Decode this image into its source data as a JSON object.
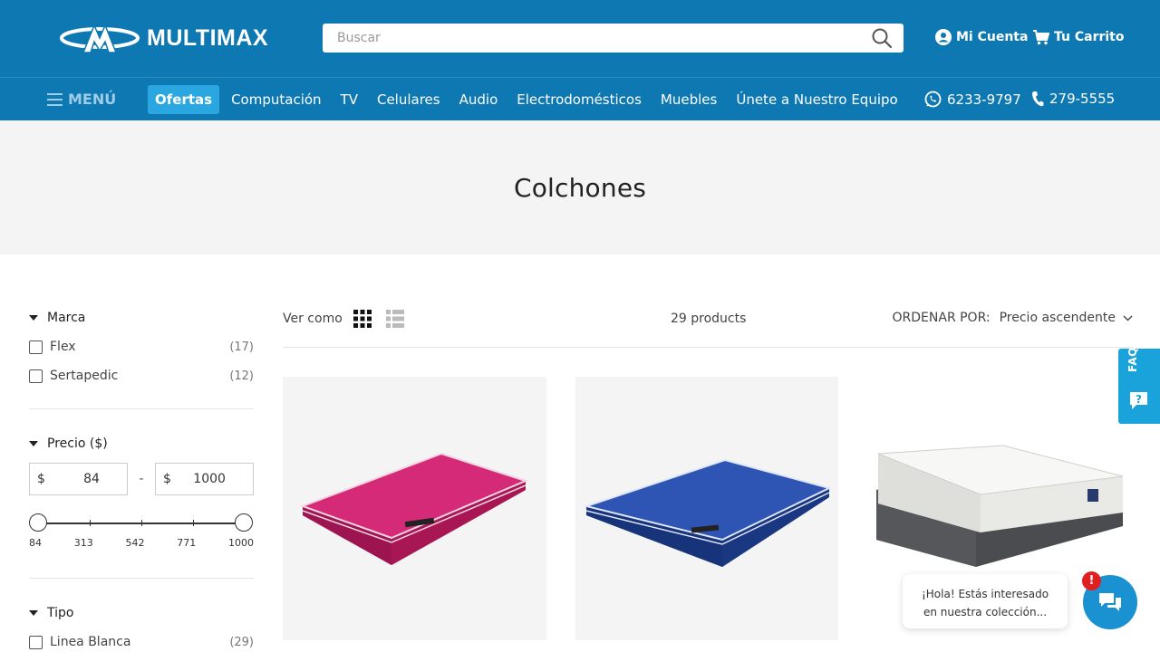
{
  "header": {
    "brand": "MULTIMAX",
    "search_placeholder": "Buscar",
    "account_label": "Mi Cuenta",
    "cart_label": "Tu Carrito"
  },
  "nav": {
    "menu_label": "MENÚ",
    "items": [
      {
        "label": "Ofertas",
        "active": true
      },
      {
        "label": "Computación"
      },
      {
        "label": "TV"
      },
      {
        "label": "Celulares"
      },
      {
        "label": "Audio"
      },
      {
        "label": "Electrodomésticos"
      },
      {
        "label": "Muebles"
      },
      {
        "label": "Únete a Nuestro Equipo"
      }
    ],
    "whatsapp_phone": "6233-9797",
    "phone": "279-5555"
  },
  "page": {
    "title": "Colchones"
  },
  "filters": {
    "brand": {
      "title": "Marca",
      "options": [
        {
          "label": "Flex",
          "count": "(17)"
        },
        {
          "label": "Sertapedic",
          "count": "(12)"
        }
      ]
    },
    "price": {
      "title": "Precio ($)",
      "currency": "$",
      "min": "84",
      "max": "1000",
      "separator": "-",
      "ticks": [
        "84",
        "313",
        "542",
        "771",
        "1000"
      ]
    },
    "type": {
      "title": "Tipo",
      "options": [
        {
          "label": "Linea Blanca",
          "count": "(29)"
        }
      ]
    }
  },
  "toolbar": {
    "view_as": "Ver como",
    "product_count": "29 products",
    "sort_label": "ORDENAR POR:",
    "sort_value": "Precio ascendente"
  },
  "products": [
    {
      "image": "pink-mattress"
    },
    {
      "image": "blue-mattress"
    },
    {
      "image": "white-mattress-with-base"
    }
  ],
  "widgets": {
    "faq_label": "FAQ",
    "chat_line1": "¡Hola! Estás interesado",
    "chat_line2": "en nuestra colección...",
    "chat_badge": "!"
  },
  "colors": {
    "header_bg": "#0e78b2",
    "active_nav": "#2aa7e0",
    "faq_bg": "#1aa3db",
    "chat_btn": "#1a91d1",
    "badge": "#e02020"
  }
}
